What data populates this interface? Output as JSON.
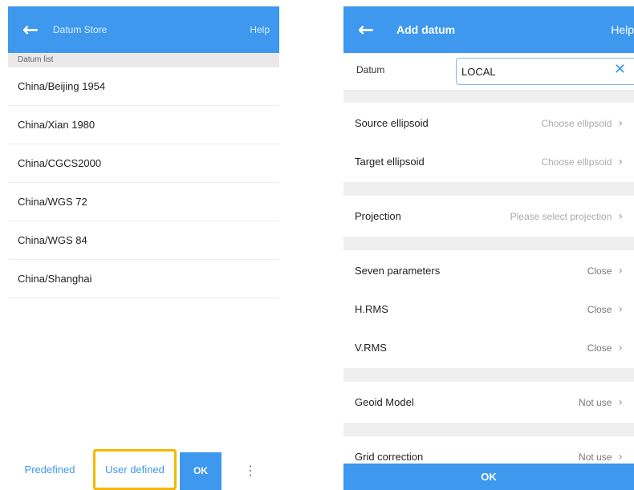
{
  "left": {
    "header": {
      "title": "Datum Store",
      "help": "Help"
    },
    "section_header": "Datum list",
    "items": [
      {
        "label": "China/Beijing 1954"
      },
      {
        "label": "China/Xian 1980"
      },
      {
        "label": "China/CGCS2000"
      },
      {
        "label": "China/WGS 72"
      },
      {
        "label": "China/WGS 84"
      },
      {
        "label": "China/Shanghai"
      }
    ],
    "bottom": {
      "predefined": "Predefined",
      "user_defined": "User defined",
      "ok": "OK",
      "more": "⋮"
    }
  },
  "right": {
    "header": {
      "title": "Add datum",
      "help": "Help"
    },
    "datum": {
      "label": "Datum",
      "value": "LOCAL",
      "clear": "✕"
    },
    "rows": {
      "source": {
        "label": "Source ellipsoid",
        "value": "Choose ellipsoid"
      },
      "target": {
        "label": "Target ellipsoid",
        "value": "Choose ellipsoid"
      },
      "projection": {
        "label": "Projection",
        "value": "Please select projection"
      },
      "seven": {
        "label": "Seven parameters",
        "value": "Close"
      },
      "hrms": {
        "label": "H.RMS",
        "value": "Close"
      },
      "vrms": {
        "label": "V.RMS",
        "value": "Close"
      },
      "geoid": {
        "label": "Geoid Model",
        "value": "Not use"
      },
      "grid": {
        "label": "Grid correction",
        "value": "Not use"
      }
    },
    "ok": "OK"
  },
  "icons": {
    "back": "arrow-left-icon",
    "chevron": "chevron-right-icon",
    "clear": "close-icon"
  },
  "colors": {
    "accent": "#3d98ee",
    "highlight": "#f5b800"
  }
}
